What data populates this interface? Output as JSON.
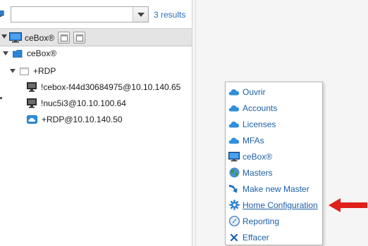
{
  "search": {
    "value": "",
    "placeholder": "",
    "results_label": "3 results"
  },
  "toolbar": {
    "label": "ceBox®"
  },
  "tree": {
    "root": {
      "label": "ceBox®"
    },
    "group": {
      "label": "+RDP"
    },
    "items": [
      {
        "label": "!cebox-f44d30684975@10.10.140.65",
        "icon": "monitor-icon"
      },
      {
        "label": "!nuc5i3@10.10.100.64",
        "icon": "monitor-icon"
      },
      {
        "label": "+RDP@10.10.140.50",
        "icon": "cloud-badge-icon"
      }
    ]
  },
  "menu": {
    "items": [
      {
        "label": "Ouvrir",
        "icon": "cloud-icon"
      },
      {
        "label": "Accounts",
        "icon": "cloud-icon"
      },
      {
        "label": "Licenses",
        "icon": "cloud-icon"
      },
      {
        "label": "MFAs",
        "icon": "cloud-icon"
      },
      {
        "label": "ceBox®",
        "icon": "monitor-icon"
      },
      {
        "label": "Masters",
        "icon": "globe-icon"
      },
      {
        "label": "Make new Master",
        "icon": "arrow-icon"
      },
      {
        "label": "Home Configuration",
        "icon": "gear-icon"
      },
      {
        "label": "Reporting",
        "icon": "compass-icon"
      },
      {
        "label": "Effacer",
        "icon": "x-icon"
      }
    ]
  },
  "colors": {
    "accent": "#1c5fa8",
    "link": "#2a6ebb",
    "arrow": "#e0201b",
    "cloud": "#2f8fdc"
  }
}
